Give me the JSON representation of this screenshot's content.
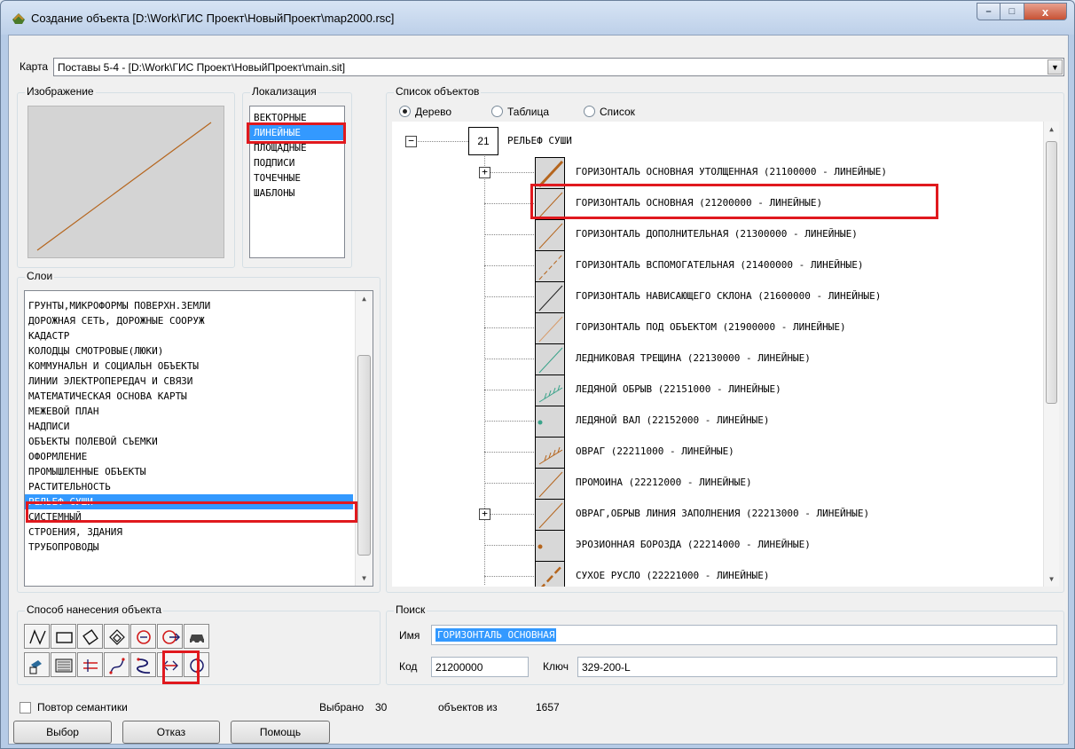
{
  "window": {
    "title": "Создание объекта  [D:\\Work\\ГИС Проект\\НовыйПроект\\map2000.rsc]",
    "buttons": {
      "minimize": "–",
      "maximize": "□",
      "close": "x"
    }
  },
  "map": {
    "label": "Карта",
    "value": "Поставы 5-4 - [D:\\Work\\ГИС Проект\\НовыйПроект\\main.sit]"
  },
  "image_group": {
    "title": "Изображение"
  },
  "localization": {
    "title": "Локализация",
    "items": [
      "ВЕКТОРНЫЕ",
      "ЛИНЕЙНЫЕ",
      "ПЛОЩАДНЫЕ",
      "ПОДПИСИ",
      "ТОЧЕЧНЫЕ",
      "ШАБЛОНЫ"
    ],
    "selected": "ЛИНЕЙНЫЕ"
  },
  "layers": {
    "title": "Слои",
    "items": [
      "ГРУНТЫ,МИКРОФОРМЫ ПОВЕРХН.ЗЕМЛИ",
      "ДОРОЖНАЯ СЕТЬ, ДОРОЖНЫЕ СООРУЖ",
      "КАДАСТР",
      "КОЛОДЦЫ СМОТРОВЫЕ(ЛЮКИ)",
      "КОММУНАЛЬН И СОЦИАЛЬН ОБЪЕКТЫ",
      "ЛИНИИ ЭЛЕКТРОПЕРЕДАЧ И СВЯЗИ",
      "МАТЕМАТИЧЕСКАЯ ОСНОВА КАРТЫ",
      "МЕЖЕВОЙ ПЛАН",
      "НАДПИСИ",
      "ОБЪЕКТЫ ПОЛЕВОЙ СЪЕМКИ",
      "ОФОРМЛЕНИЕ",
      "ПРОМЫШЛЕННЫЕ ОБЪЕКТЫ",
      "РАСТИТЕЛЬНОСТЬ",
      "РЕЛЬЕФ  СУШИ",
      "СИСТЕМНЫЙ",
      "СТРОЕНИЯ, ЗДАНИЯ",
      "ТРУБОПРОВОДЫ"
    ],
    "selected": "РЕЛЬЕФ  СУШИ"
  },
  "objects": {
    "title": "Список объектов",
    "view_options": [
      "Дерево",
      "Таблица",
      "Список"
    ],
    "selected_view": "Дерево",
    "root": {
      "code": "21",
      "label": "РЕЛЬЕФ  СУШИ",
      "expander": "−"
    },
    "items": [
      {
        "label": "ГОРИЗОНТАЛЬ ОСНОВНАЯ УТОЛЩЕННАЯ (21100000 - ЛИНЕЙНЫЕ)",
        "icon": "thick-brown-line-icon",
        "expander": "+"
      },
      {
        "label": "ГОРИЗОНТАЛЬ ОСНОВНАЯ  (21200000 - ЛИНЕЙНЫЕ)",
        "icon": "thin-brown-line-icon"
      },
      {
        "label": "ГОРИЗОНТАЛЬ ДОПОЛНИТЕЛЬНАЯ (21300000 - ЛИНЕЙНЫЕ)",
        "icon": "thin-brown-line-icon"
      },
      {
        "label": "ГОРИЗОНТАЛЬ ВСПОМОГАТЕЛЬНАЯ (21400000 - ЛИНЕЙНЫЕ)",
        "icon": "dashed-brown-line-icon"
      },
      {
        "label": "ГОРИЗОНТАЛЬ НАВИСАЮЩЕГО СКЛОНА (21600000 - ЛИНЕЙНЫЕ)",
        "icon": "black-line-icon"
      },
      {
        "label": "ГОРИЗОНТАЛЬ ПОД ОБЪЕКТОМ (21900000 - ЛИНЕЙНЫЕ)",
        "icon": "light-brown-line-icon"
      },
      {
        "label": "ЛЕДНИКОВАЯ ТРЕЩИНА (22130000 - ЛИНЕЙНЫЕ)",
        "icon": "teal-line-icon"
      },
      {
        "label": "ЛЕДЯНОЙ ОБРЫВ (22151000 - ЛИНЕЙНЫЕ)",
        "icon": "teal-cliff-icon"
      },
      {
        "label": "ЛЕДЯНОЙ ВАЛ   (22152000 - ЛИНЕЙНЫЕ)",
        "icon": "teal-dot-icon"
      },
      {
        "label": "ОВРАГ (22211000 - ЛИНЕЙНЫЕ)",
        "icon": "brown-cliff-icon"
      },
      {
        "label": "ПРОМОИНА (22212000 - ЛИНЕЙНЫЕ)",
        "icon": "thin-brown-line-icon"
      },
      {
        "label": "ОВРАГ,ОБРЫВ ЛИНИЯ ЗАПОЛНЕНИЯ (22213000 - ЛИНЕЙНЫЕ)",
        "icon": "thin-brown-line-icon",
        "expander": "+"
      },
      {
        "label": "ЭРОЗИОННАЯ БОРОЗДА    (22214000 - ЛИНЕЙНЫЕ)",
        "icon": "brown-dot-icon"
      },
      {
        "label": "СУХОЕ РУСЛО (22221000 - ЛИНЕЙНЫЕ)",
        "icon": "dashed-thick-brown-line-icon"
      }
    ],
    "selected": "ГОРИЗОНТАЛЬ ОСНОВНАЯ  (21200000 - ЛИНЕЙНЫЕ)"
  },
  "method": {
    "title": "Способ нанесения объекта"
  },
  "search": {
    "title": "Поиск",
    "name_label": "Имя",
    "name_value": "ГОРИЗОНТАЛЬ ОСНОВНАЯ",
    "code_label": "Код",
    "code_value": "21200000",
    "key_label": "Ключ",
    "key_value": "329-200-L"
  },
  "footer": {
    "repeat_semantics": "Повтор семантики",
    "selected_label": "Выбрано",
    "selected_count": "30",
    "of_label": "объектов из",
    "total": "1657",
    "btn_select": "Выбор",
    "btn_cancel": "Отказ",
    "btn_help": "Помощь"
  },
  "colors": {
    "selection": "#3399ff",
    "highlight_frame": "#e0191e",
    "contour_brown": "#b5651d",
    "ice_teal": "#3aa38a"
  }
}
